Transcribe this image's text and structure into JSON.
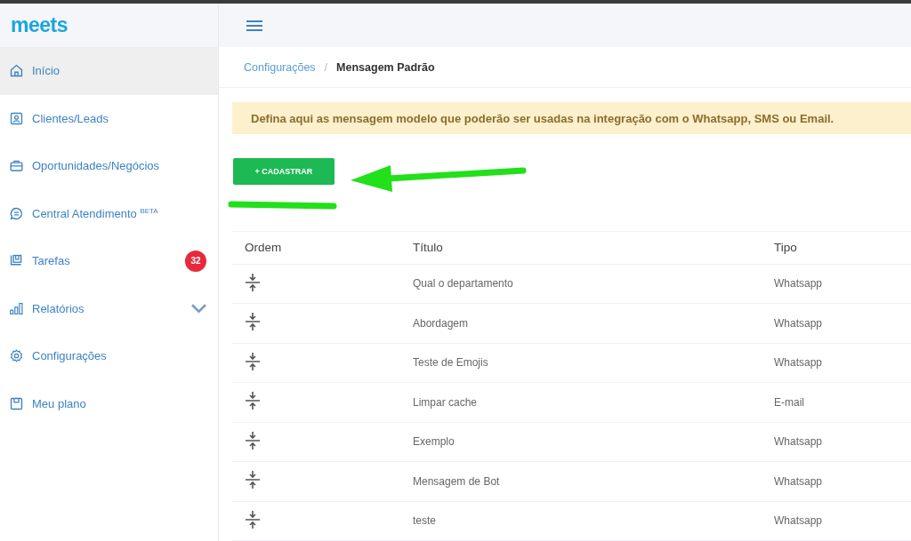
{
  "logo": "meets",
  "sidebar": {
    "items": [
      {
        "label": "Início",
        "selected": true
      },
      {
        "label": "Clientes/Leads",
        "selected": false
      },
      {
        "label": "Oportunidades/Negócios",
        "selected": false
      },
      {
        "label": "Central Atendimento $^{BETA}$",
        "selected": false
      },
      {
        "label": "Tarefas",
        "selected": false,
        "badge": "32"
      },
      {
        "label": "Relatórios",
        "selected": false,
        "expanded": false
      },
      {
        "label": "Configurações",
        "selected": false
      },
      {
        "label": "Meu plano",
        "selected": false
      }
    ]
  },
  "breadcrumb": {
    "parent": "Configurações",
    "separator": "/",
    "current": "Mensagem Padrão"
  },
  "alert": "Defina aqui as mensagem modelo que poderão ser usadas na integração com o Whatsapp, SMS ou Email.",
  "add_button": "+ CADASTRAR",
  "table": {
    "columns": [
      "Ordem",
      "Título",
      "Tipo"
    ],
    "rows": [
      {
        "title": "Qual o departamento",
        "type": "Whatsapp"
      },
      {
        "title": "Abordagem",
        "type": "Whatsapp"
      },
      {
        "title": "Teste de Emojis",
        "type": "Whatsapp"
      },
      {
        "title": "Limpar cache",
        "type": "E-mail"
      },
      {
        "title": "Exemplo",
        "type": "Whatsapp"
      },
      {
        "title": "Mensagem de Bot",
        "type": "Whatsapp"
      },
      {
        "title": "teste",
        "type": "Whatsapp"
      }
    ]
  }
}
